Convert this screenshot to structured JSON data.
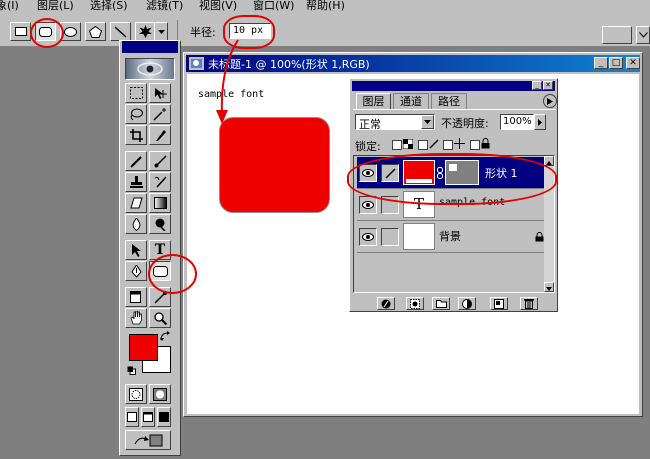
{
  "menu": [
    "象(I)",
    "图层(L)",
    "选择(S)",
    "滤镜(T)",
    "视图(V)",
    "窗口(W)",
    "帮助(H)"
  ],
  "options": {
    "radius_label": "半径:",
    "radius_value": "10 px"
  },
  "document": {
    "title": "未标题-1 @ 100%(形状 1,RGB)",
    "text_layer_content": "sample font",
    "shape_color": "#ee0000"
  },
  "layers_panel": {
    "tabs": [
      "图层",
      "通道",
      "路径"
    ],
    "blend_mode": "正常",
    "opacity_label": "不透明度:",
    "opacity_value": "100%",
    "lock_label": "锁定:",
    "layers": [
      {
        "name": "形状 1",
        "type": "shape",
        "selected": true
      },
      {
        "name": "sample font",
        "type": "text",
        "selected": false
      },
      {
        "name": "背景",
        "type": "background",
        "selected": false,
        "locked": true
      }
    ],
    "text_layer_glyph": "T"
  },
  "colors": {
    "foreground": "#ee0000",
    "background": "#ffffff",
    "annotation": "#e00000"
  }
}
